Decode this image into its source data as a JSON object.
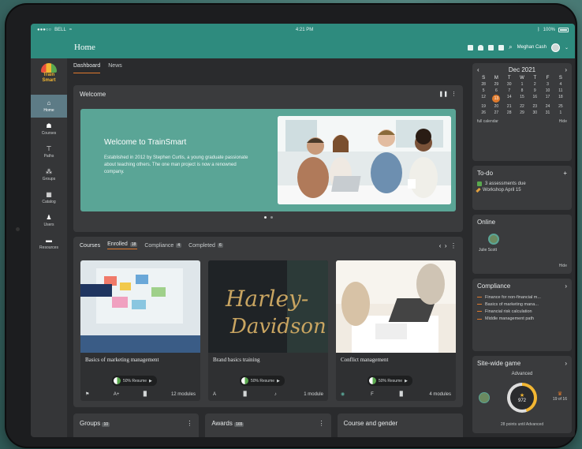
{
  "status_bar": {
    "carrier": "BELL",
    "time": "4:21 PM",
    "battery": "100%"
  },
  "header": {
    "title": "Home",
    "user": "Meghan Cash"
  },
  "logo": {
    "line1": "Train",
    "line2": "Smart"
  },
  "sidebar": {
    "items": [
      {
        "label": "Home",
        "icon": "home-icon"
      },
      {
        "label": "Courses",
        "icon": "courses-icon"
      },
      {
        "label": "Paths",
        "icon": "paths-icon"
      },
      {
        "label": "Groups",
        "icon": "groups-icon"
      },
      {
        "label": "Catalog",
        "icon": "catalog-icon"
      },
      {
        "label": "Users",
        "icon": "users-icon"
      },
      {
        "label": "Resources",
        "icon": "resources-icon"
      }
    ]
  },
  "main_tabs": [
    "Dashboard",
    "News"
  ],
  "welcome": {
    "card_title": "Welcome",
    "heading": "Welcome to TrainSmart",
    "text": "Established in 2012 by Stephen Curtis, a young graduate passionate about teaching others. The one man project is now a renowned company."
  },
  "courses": {
    "title": "Courses",
    "tabs": [
      {
        "label": "Enrolled",
        "count": "18"
      },
      {
        "label": "Compliance",
        "count": "4"
      },
      {
        "label": "Completed",
        "count": "6"
      }
    ],
    "cards": [
      {
        "name": "Basics of marketing management",
        "progress": "50% Resume",
        "modules": "12 modules",
        "foot1": "A+"
      },
      {
        "name": "Brand basics training",
        "progress": "50% Resume",
        "modules": "1 module",
        "foot1": "A"
      },
      {
        "name": "Conflict management",
        "progress": "50% Resume",
        "modules": "4 modules",
        "foot1": "F"
      }
    ]
  },
  "bottom": {
    "groups": "Groups",
    "groups_count": "10",
    "awards": "Awards",
    "awards_count": "165",
    "gender": "Course and gender"
  },
  "calendar": {
    "month": "Dec 2021",
    "weekdays": [
      "S",
      "M",
      "T",
      "W",
      "T",
      "F",
      "S"
    ],
    "days": [
      "28",
      "29",
      "30",
      "1",
      "2",
      "3",
      "4",
      "5",
      "6",
      "7",
      "8",
      "9",
      "10",
      "11",
      "12",
      "13",
      "14",
      "15",
      "16",
      "17",
      "18",
      "19",
      "20",
      "21",
      "22",
      "23",
      "24",
      "25",
      "26",
      "27",
      "28",
      "29",
      "30",
      "31",
      "1"
    ],
    "today": "13",
    "full_link": "full calendar",
    "hide": "Hide"
  },
  "todo": {
    "title": "To-do",
    "items": [
      "3 assessments due",
      "Workshop April 15"
    ]
  },
  "online": {
    "title": "Online",
    "user": "Julie Scott",
    "hide": "Hide"
  },
  "compliance": {
    "title": "Compliance",
    "items": [
      "Finance for non-financial m...",
      "Basics of marketing mana...",
      "Financial risk calculation",
      "Middle management path"
    ]
  },
  "game": {
    "title": "Site-wide game",
    "level": "Advanced",
    "points": "972",
    "rank": "19 of 16",
    "footer": "28 points until Advanced",
    "progress": 0.45
  }
}
